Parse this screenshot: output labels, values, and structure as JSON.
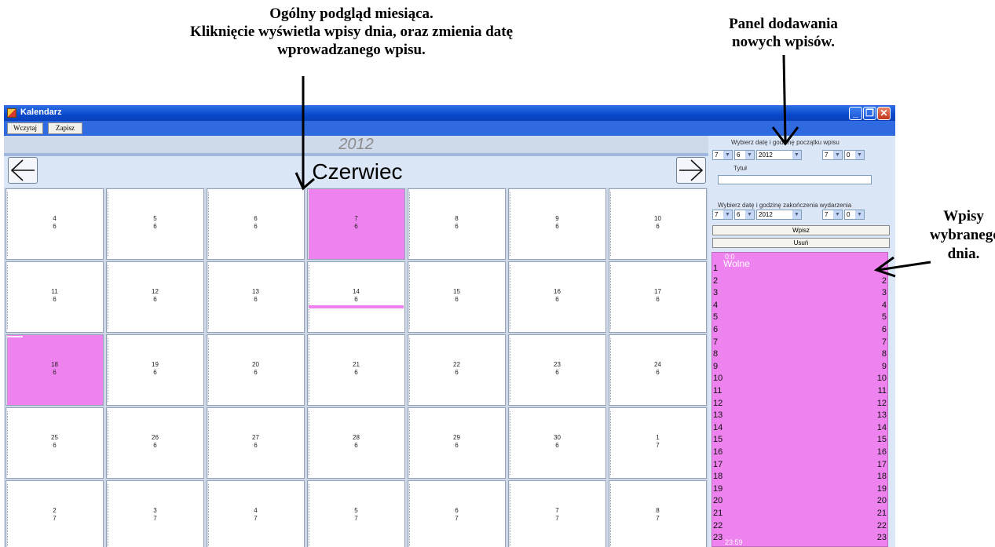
{
  "annotations": {
    "month_overview": [
      "Ogólny podgląd miesiąca.",
      "Kliknięcie wyświetla wpisy dnia, oraz zmienia datę",
      "wprowadzanego wpisu."
    ],
    "add_panel": [
      "Panel dodawania",
      "nowych wpisów."
    ],
    "day_entries": [
      "Wpisy",
      "wybranego",
      "dnia."
    ]
  },
  "window": {
    "title": "Kalendarz",
    "controls": [
      "minimize",
      "maximize",
      "close"
    ]
  },
  "toolbar": {
    "load_label": "Wczytaj",
    "save_label": "Zapisz"
  },
  "calendar": {
    "year": "2012",
    "month": "Czerwiec",
    "prev_icon": "arrow-left-icon",
    "next_icon": "arrow-right-icon",
    "highlight_color": "#ee82ee",
    "weeks": [
      [
        {
          "day": "4",
          "month": "6"
        },
        {
          "day": "5",
          "month": "6"
        },
        {
          "day": "6",
          "month": "6"
        },
        {
          "day": "7",
          "month": "6",
          "highlighted": true
        },
        {
          "day": "8",
          "month": "6"
        },
        {
          "day": "9",
          "month": "6"
        },
        {
          "day": "10",
          "month": "6"
        }
      ],
      [
        {
          "day": "11",
          "month": "6"
        },
        {
          "day": "12",
          "month": "6"
        },
        {
          "day": "13",
          "month": "6"
        },
        {
          "day": "14",
          "month": "6",
          "has_event_bar": true
        },
        {
          "day": "15",
          "month": "6"
        },
        {
          "day": "16",
          "month": "6"
        },
        {
          "day": "17",
          "month": "6"
        }
      ],
      [
        {
          "day": "18",
          "month": "6",
          "highlighted": true
        },
        {
          "day": "19",
          "month": "6"
        },
        {
          "day": "20",
          "month": "6"
        },
        {
          "day": "21",
          "month": "6"
        },
        {
          "day": "22",
          "month": "6"
        },
        {
          "day": "23",
          "month": "6"
        },
        {
          "day": "24",
          "month": "6"
        }
      ],
      [
        {
          "day": "25",
          "month": "6"
        },
        {
          "day": "26",
          "month": "6"
        },
        {
          "day": "27",
          "month": "6"
        },
        {
          "day": "28",
          "month": "6"
        },
        {
          "day": "29",
          "month": "6"
        },
        {
          "day": "30",
          "month": "6"
        },
        {
          "day": "1",
          "month": "7"
        }
      ],
      [
        {
          "day": "2",
          "month": "7"
        },
        {
          "day": "3",
          "month": "7"
        },
        {
          "day": "4",
          "month": "7"
        },
        {
          "day": "5",
          "month": "7"
        },
        {
          "day": "6",
          "month": "7"
        },
        {
          "day": "7",
          "month": "7"
        },
        {
          "day": "8",
          "month": "7"
        }
      ]
    ]
  },
  "entry_panel": {
    "start_label": "Wybierz datę i godzinę początku wpisu",
    "start": {
      "day": "7",
      "month": "6",
      "year": "2012",
      "hour": "7",
      "minute": "0"
    },
    "title_label": "Tytuł",
    "title_value": "",
    "end_label": "Wybierz datę i godzinę zakończenia wydarzenia",
    "end": {
      "day": "7",
      "month": "6",
      "year": "2012",
      "hour": "7",
      "minute": "0"
    },
    "add_button": "Wpisz",
    "delete_button": "Usuń"
  },
  "day_view": {
    "event_start": "0:0",
    "event_title": "Wolne",
    "event_end": "23:59",
    "hours_left": [
      "1",
      "2",
      "3",
      "4",
      "5",
      "6",
      "7",
      "8",
      "9",
      "10",
      "11",
      "12",
      "13",
      "14",
      "15",
      "16",
      "17",
      "18",
      "19",
      "20",
      "21",
      "22",
      "23"
    ],
    "hours_right": [
      "2",
      "3",
      "4",
      "5",
      "6",
      "7",
      "8",
      "9",
      "10",
      "11",
      "12",
      "13",
      "14",
      "15",
      "16",
      "17",
      "18",
      "19",
      "20",
      "21",
      "22",
      "23"
    ]
  }
}
